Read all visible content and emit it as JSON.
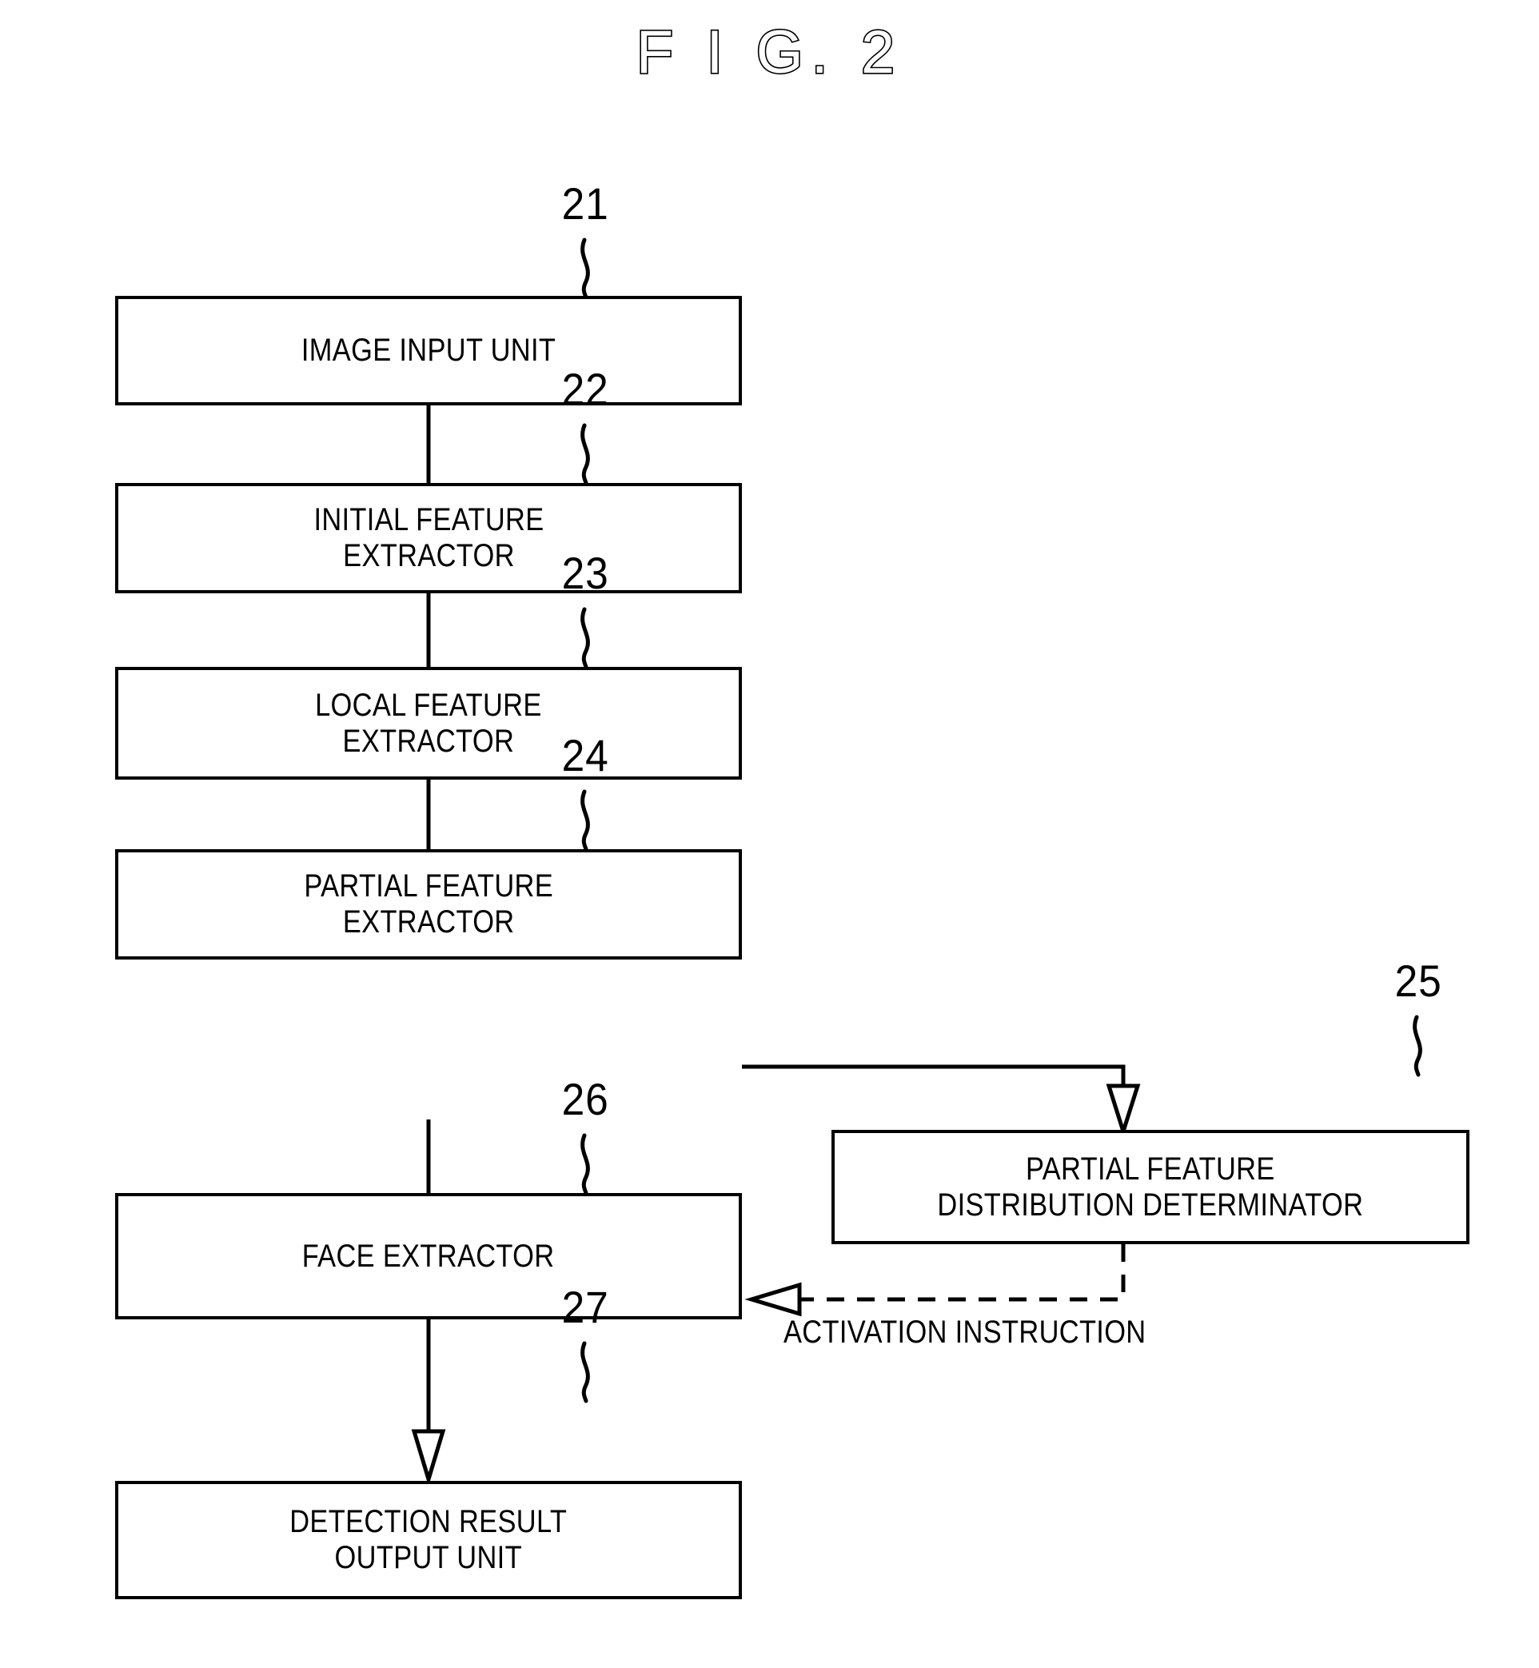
{
  "figure": {
    "title": "F I G.  2",
    "type": "patent-block-diagram",
    "stroke_color": "#000000",
    "background_color": "#ffffff"
  },
  "blocks": [
    {
      "ref": "21",
      "label": "IMAGE INPUT UNIT"
    },
    {
      "ref": "22",
      "label": "INITIAL FEATURE\nEXTRACTOR"
    },
    {
      "ref": "23",
      "label": "LOCAL FEATURE\nEXTRACTOR"
    },
    {
      "ref": "24",
      "label": "PARTIAL FEATURE\nEXTRACTOR"
    },
    {
      "ref": "25",
      "label": "PARTIAL FEATURE\nDISTRIBUTION DETERMINATOR"
    },
    {
      "ref": "26",
      "label": "FACE EXTRACTOR"
    },
    {
      "ref": "27",
      "label": "DETECTION RESULT\nOUTPUT UNIT"
    }
  ],
  "annotations": {
    "activation_instruction": "ACTIVATION INSTRUCTION"
  },
  "connections": [
    {
      "from": "21",
      "to": "22",
      "style": "solid",
      "arrow": "hollow"
    },
    {
      "from": "22",
      "to": "23",
      "style": "solid",
      "arrow": "hollow"
    },
    {
      "from": "23",
      "to": "24",
      "style": "solid",
      "arrow": "hollow"
    },
    {
      "from": "24",
      "to": "25",
      "style": "solid",
      "arrow": "hollow"
    },
    {
      "from": "24",
      "to": "26",
      "style": "solid",
      "arrow": "hollow"
    },
    {
      "from": "25",
      "to": "26",
      "style": "dashed",
      "arrow": "hollow",
      "label": "ACTIVATION INSTRUCTION"
    },
    {
      "from": "26",
      "to": "27",
      "style": "solid",
      "arrow": "hollow"
    }
  ]
}
